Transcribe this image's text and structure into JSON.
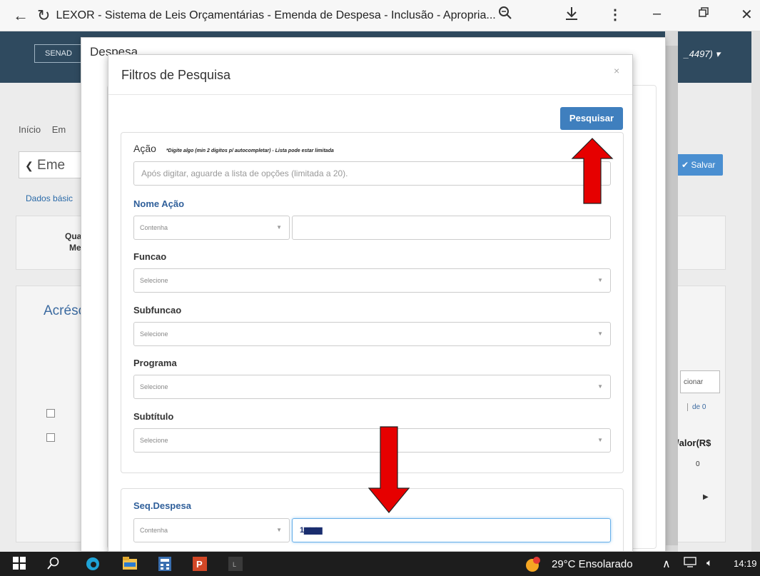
{
  "browser": {
    "back_icon": "arrow-left-icon",
    "reload_icon": "reload-icon",
    "title": "LEXOR - Sistema de Leis Orçamentárias - Emenda de Despesa - Inclusão - Apropria...",
    "zoom_icon": "zoom-icon",
    "download_icon": "download-icon",
    "menu_icon": "kebab-menu-icon",
    "minimize_icon": "minimize-icon",
    "restore_icon": "restore-icon",
    "close_icon": "close-icon"
  },
  "background_page": {
    "brand": "SENAD",
    "user": "_4497)",
    "breadcrumb": [
      "Início",
      "Em"
    ],
    "page_title": "Eme",
    "save_label": "Salvar",
    "tab": "Dados básic",
    "card_label_1": "Qua",
    "card_label_2": "Me",
    "section_title": "Acrésc",
    "adicionar_label": "cionar",
    "pagination": "de 0",
    "valor_header": "/alor(R$",
    "valor_value": "0"
  },
  "outer_modal": {
    "title": "Despesa"
  },
  "filter_modal": {
    "title": "Filtros de Pesquisa",
    "close": "×",
    "search_button": "Pesquisar",
    "acao": {
      "label": "Ação",
      "hint": "*Digite algo (min 2 digitos p/ autocompletar) - Lista pode estar limitada",
      "placeholder": "Após digitar, aguarde a lista de opções (limitada a 20)."
    },
    "nome_acao": {
      "label": "Nome Ação",
      "operator": "Contenha",
      "value": ""
    },
    "funcao": {
      "label": "Funcao",
      "value": "Selecione"
    },
    "subfuncao": {
      "label": "Subfuncao",
      "value": "Selecione"
    },
    "programa": {
      "label": "Programa",
      "value": "Selecione"
    },
    "subtitulo": {
      "label": "Subtítulo",
      "value": "Selecione"
    },
    "seq_despesa": {
      "label": "Seq.Despesa",
      "operator": "Contenha",
      "value": "1▆▆▆"
    }
  },
  "taskbar": {
    "weather": "29°C  Ensolarado",
    "time": "14:19"
  },
  "colors": {
    "primary_button": "#3f7fbe",
    "header_bg": "#2f4a5f",
    "arrow_red": "#e60000",
    "label_blue": "#2f5f9a"
  }
}
